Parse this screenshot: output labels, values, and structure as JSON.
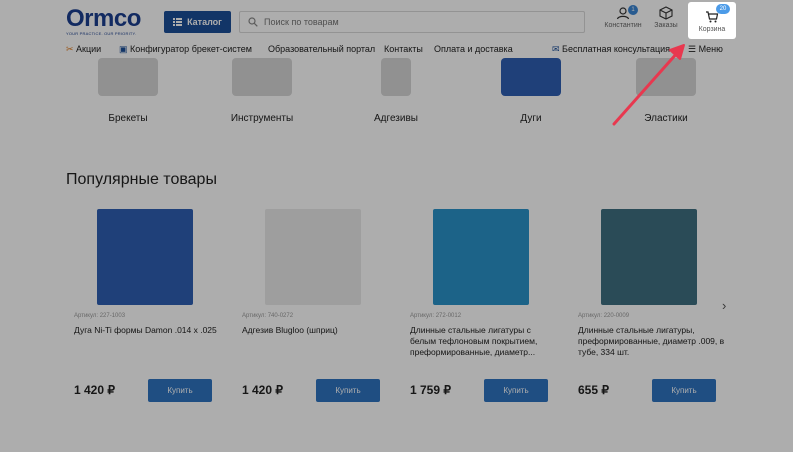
{
  "logo": {
    "main": "Ormco",
    "tagline": "YOUR PRACTICE. OUR PRIORITY."
  },
  "header": {
    "catalog_label": "Каталог",
    "search_placeholder": "Поиск по товарам",
    "profile": {
      "label": "Константин",
      "badge": "1",
      "icon": "user-icon"
    },
    "orders": {
      "label": "Заказы",
      "icon": "box-icon"
    },
    "cart": {
      "label": "Корзина",
      "badge": "20",
      "icon": "cart-icon"
    }
  },
  "nav": {
    "promo": "Акции",
    "configurator": "Конфигуратор брекет-систем",
    "education": "Образовательный портал",
    "contacts": "Контакты",
    "payment": "Оплата и доставка",
    "consult": "Бесплатная консультация",
    "menu": "Меню"
  },
  "categories": [
    {
      "label": "Брекеты"
    },
    {
      "label": "Инструменты"
    },
    {
      "label": "Адгезивы"
    },
    {
      "label": "Дуги"
    },
    {
      "label": "Эластики"
    }
  ],
  "popular": {
    "title": "Популярные товары",
    "products": [
      {
        "sku": "Артикул: 227-1003",
        "name": "Дуга Ni-Ti формы Damon .014 x .025",
        "price": "1 420 ₽",
        "buy": "Купить",
        "img_color": "#2e5fb3"
      },
      {
        "sku": "Артикул: 740-0272",
        "name": "Адгезив Blugloo (шприц)",
        "price": "1 420 ₽",
        "buy": "Купить",
        "img_color": "#e9e9e9"
      },
      {
        "sku": "Артикул: 272-0012",
        "name": "Длинные стальные лигатуры с белым тефлоновым покрытием, преформированные, диаметр...",
        "price": "1 759 ₽",
        "buy": "Купить",
        "img_color": "#2a93c9"
      },
      {
        "sku": "Артикул: 220-0009",
        "name": "Длинные стальные лигатуры, преформированные, диаметр .009, в тубе, 334 шт.",
        "price": "655 ₽",
        "buy": "Купить",
        "img_color": "#3f6f80"
      }
    ]
  },
  "colors": {
    "brand": "#1b4e98",
    "button": "#2f74c0",
    "promo": "#e07b1f",
    "annotation_arrow": "#e8384f"
  }
}
